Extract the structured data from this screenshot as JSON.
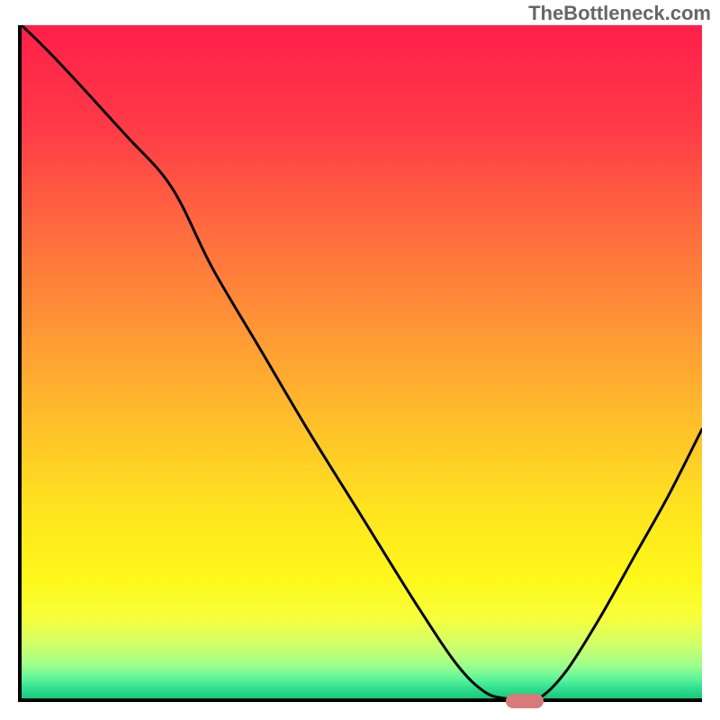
{
  "watermark": "TheBottleneck.com",
  "chart_data": {
    "type": "line",
    "title": "",
    "xlabel": "",
    "ylabel": "",
    "xlim": [
      0,
      100
    ],
    "ylim": [
      0,
      100
    ],
    "grid": false,
    "series": [
      {
        "name": "bottleneck-curve",
        "x": [
          0,
          5,
          15,
          22,
          28,
          35,
          42,
          50,
          58,
          64,
          68,
          71,
          73,
          76,
          80,
          85,
          90,
          95,
          100
        ],
        "values": [
          100,
          95,
          84,
          76,
          64,
          52,
          40,
          27,
          14,
          5,
          1,
          0,
          0,
          0,
          4,
          12,
          21,
          30,
          40
        ]
      }
    ],
    "marker": {
      "x_start": 71,
      "x_end": 76,
      "y": 0
    },
    "background_gradient": {
      "stops": [
        {
          "offset": 0.0,
          "color": "#ff1f4a"
        },
        {
          "offset": 0.15,
          "color": "#ff3a47"
        },
        {
          "offset": 0.3,
          "color": "#ff6a3f"
        },
        {
          "offset": 0.45,
          "color": "#ff9636"
        },
        {
          "offset": 0.6,
          "color": "#ffc22a"
        },
        {
          "offset": 0.72,
          "color": "#ffe41f"
        },
        {
          "offset": 0.82,
          "color": "#fff71a"
        },
        {
          "offset": 0.88,
          "color": "#f7ff3a"
        },
        {
          "offset": 0.92,
          "color": "#d0ff6a"
        },
        {
          "offset": 0.95,
          "color": "#a0ff8a"
        },
        {
          "offset": 0.97,
          "color": "#60f59a"
        },
        {
          "offset": 0.985,
          "color": "#30e090"
        },
        {
          "offset": 1.0,
          "color": "#18c878"
        }
      ]
    }
  }
}
